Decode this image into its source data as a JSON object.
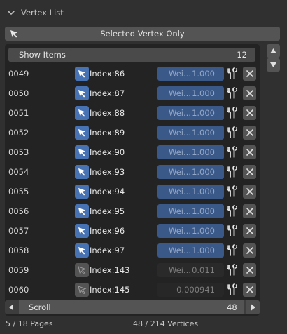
{
  "panel": {
    "title": "Vertex List"
  },
  "selected_button": {
    "label": "Selected Vertex Only"
  },
  "list_header": {
    "label": "Show Items",
    "count": "12"
  },
  "rows": [
    {
      "id": "0049",
      "name": "Index:86",
      "weight_label": "Wei...",
      "weight": "1.000",
      "active": true
    },
    {
      "id": "0050",
      "name": "Index:87",
      "weight_label": "Wei...",
      "weight": "1.000",
      "active": true
    },
    {
      "id": "0051",
      "name": "Index:88",
      "weight_label": "Wei...",
      "weight": "1.000",
      "active": true
    },
    {
      "id": "0052",
      "name": "Index:89",
      "weight_label": "Wei...",
      "weight": "1.000",
      "active": true
    },
    {
      "id": "0053",
      "name": "Index:90",
      "weight_label": "Wei...",
      "weight": "1.000",
      "active": true
    },
    {
      "id": "0054",
      "name": "Index:93",
      "weight_label": "Wei...",
      "weight": "1.000",
      "active": true
    },
    {
      "id": "0055",
      "name": "Index:94",
      "weight_label": "Wei...",
      "weight": "1.000",
      "active": true
    },
    {
      "id": "0056",
      "name": "Index:95",
      "weight_label": "Wei...",
      "weight": "1.000",
      "active": true
    },
    {
      "id": "0057",
      "name": "Index:96",
      "weight_label": "Wei...",
      "weight": "1.000",
      "active": true
    },
    {
      "id": "0058",
      "name": "Index:97",
      "weight_label": "Wei...",
      "weight": "1.000",
      "active": true
    },
    {
      "id": "0059",
      "name": "Index:143",
      "weight_label": "Wei...",
      "weight": "0.011",
      "active": false
    },
    {
      "id": "0060",
      "name": "Index:145",
      "weight_label": "",
      "weight": "0.000941",
      "active": false
    }
  ],
  "scroll": {
    "label": "Scroll",
    "value": "48"
  },
  "footer": {
    "pages": "5 / 18 Pages",
    "vertices": "48 / 214 Vertices"
  },
  "icons": {
    "collapse": "chevron-down-icon",
    "cursor": "cursor-arrow-icon",
    "wrench": "wrench-icon",
    "remove": "close-icon",
    "up": "triangle-up-icon",
    "down": "triangle-down-icon",
    "left": "triangle-left-icon",
    "right": "triangle-right-icon"
  },
  "colors": {
    "accent": "#4772b3",
    "field_active": "#3a5989",
    "background": "#303030"
  }
}
